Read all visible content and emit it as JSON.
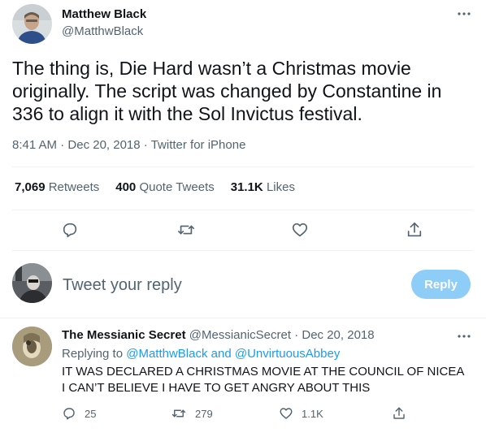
{
  "tweet": {
    "author_name": "Matthew Black",
    "author_handle": "@MatthwBlack",
    "text": "The thing is, Die Hard wasn’t a Christmas movie originally. The script was changed by Constantine in 336 to align it with the Sol Invictus festival.",
    "time": "8:41 AM",
    "date": "Dec 20, 2018",
    "source": "Twitter for iPhone",
    "retweets_count": "7,069",
    "retweets_label": "Retweets",
    "quotes_count": "400",
    "quotes_label": "Quote Tweets",
    "likes_count": "31.1K",
    "likes_label": "Likes"
  },
  "compose": {
    "placeholder": "Tweet your reply",
    "button_label": "Reply"
  },
  "reply": {
    "author_name": "The Messianic Secret",
    "author_handle": "@MessianicSecret",
    "date": "Dec 20, 2018",
    "replying_to_prefix": "Replying to",
    "mention1": "@MatthwBlack",
    "and": "and",
    "mention2": "@UnvirtuousAbbey",
    "text": "IT WAS DECLARED A CHRISTMAS MOVIE AT THE COUNCIL OF NICEA I CAN’T BELIEVE I HAVE TO GET ANGRY ABOUT THIS",
    "reply_count": "25",
    "retweet_count": "279",
    "like_count": "1.1K"
  },
  "icons": {
    "more": "more-horizontal-icon",
    "reply": "reply-bubble-icon",
    "retweet": "retweet-icon",
    "like": "heart-icon",
    "share": "share-icon"
  },
  "colors": {
    "accent": "#1d9bf0",
    "reply_button_disabled": "#8ecdf8",
    "secondary_text": "#536471",
    "divider": "#eff3f4"
  }
}
